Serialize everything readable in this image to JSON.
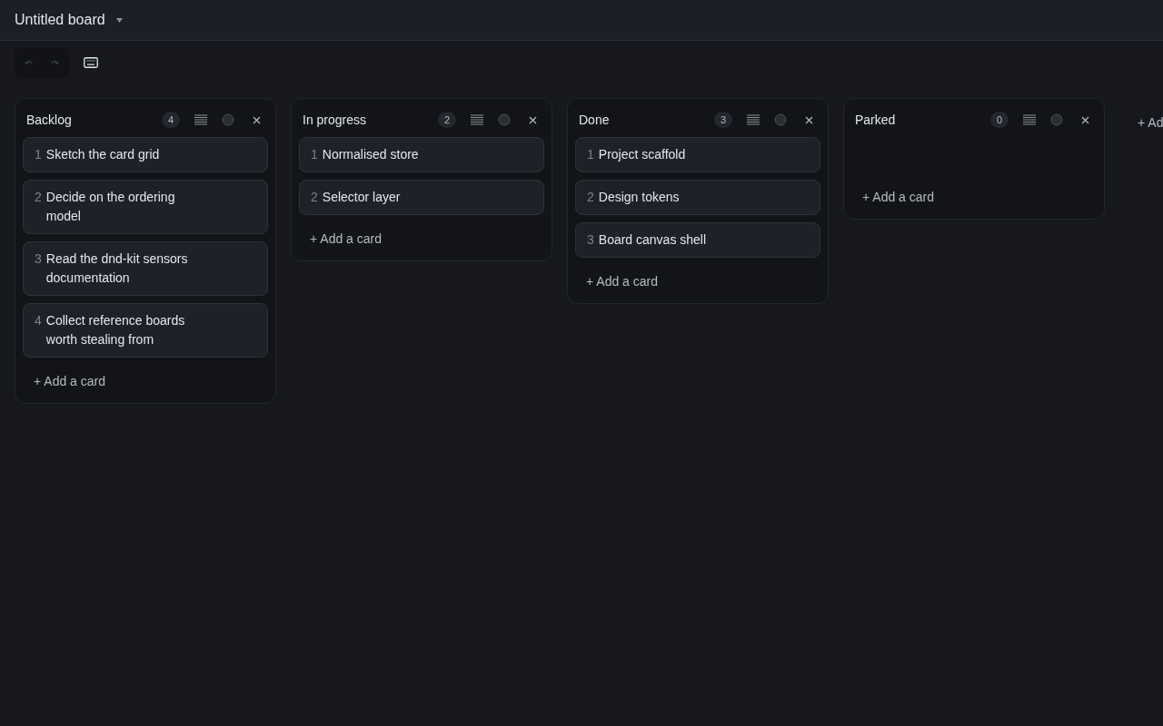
{
  "board": {
    "title": "Untitled board"
  },
  "toolbar": {
    "undo": {
      "disabled": true
    },
    "redo": {
      "disabled": true
    }
  },
  "columns": [
    {
      "title": "Backlog",
      "count": "4",
      "cards": [
        {
          "number": "1",
          "text": "Sketch the card grid"
        },
        {
          "number": "2",
          "text": "Decide on the ordering model"
        },
        {
          "number": "3",
          "text": "Read the dnd-kit sensors documentation"
        },
        {
          "number": "4",
          "text": "Collect reference boards worth stealing from"
        }
      ],
      "add_label": "+ Add a card"
    },
    {
      "title": "In progress",
      "count": "2",
      "cards": [
        {
          "number": "1",
          "text": "Normalised store"
        },
        {
          "number": "2",
          "text": "Selector layer"
        }
      ],
      "add_label": "+ Add a card"
    },
    {
      "title": "Done",
      "count": "3",
      "cards": [
        {
          "number": "1",
          "text": "Project scaffold"
        },
        {
          "number": "2",
          "text": "Design tokens"
        },
        {
          "number": "3",
          "text": "Board canvas shell"
        }
      ],
      "add_label": "+ Add a card"
    },
    {
      "title": "Parked",
      "count": "0",
      "add_label": "+ Add a card"
    }
  ],
  "add_list_label": "+ Ad"
}
